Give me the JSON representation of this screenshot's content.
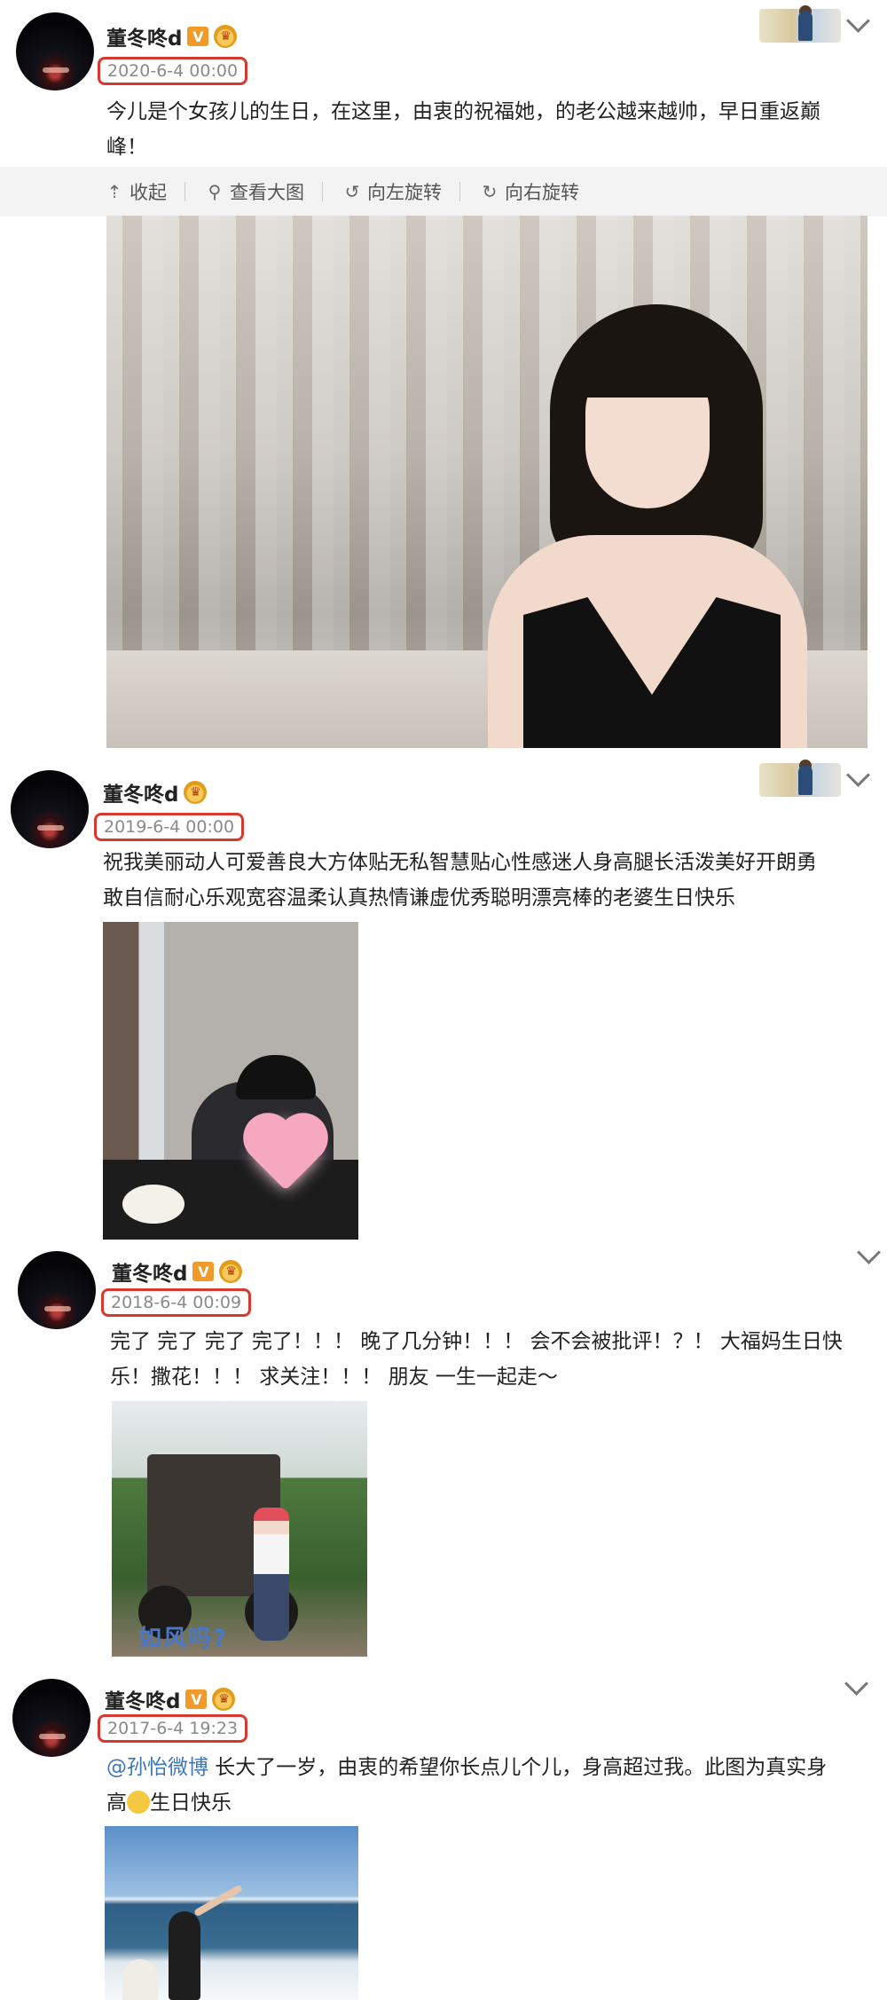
{
  "posts": [
    {
      "username": "董冬咚d",
      "timestamp": "2020-6-4 00:00",
      "content": "今儿是个女孩儿的生日，在这里，由衷的祝福她，的老公越来越帅，早日重返巅峰！",
      "content_lines": [
        "今儿是个女孩儿的生日，在这里，由衷的祝福她，的老公越来越帅，早日重返巅",
        "峰！"
      ],
      "toolbar": {
        "collapse": "收起",
        "view_large": "查看大图",
        "rotate_left": "向左旋转",
        "rotate_right": "向右旋转"
      }
    },
    {
      "username": "董冬咚d",
      "timestamp": "2019-6-4 00:00",
      "content_lines": [
        "祝我美丽动人可爱善良大方体贴无私智慧贴心性感迷人身高腿长活泼美好开朗勇",
        "敢自信耐心乐观宽容温柔认真热情谦虚优秀聪明漂亮棒的老婆生日快乐"
      ]
    },
    {
      "username": "董冬咚d",
      "timestamp": "2018-6-4 00:09",
      "content_lines": [
        "完了 完了 完了 完了！！！ 晚了几分钟！！！ 会不会被批评！？！ 大福妈生日快",
        "乐！撒花！！！ 求关注！！！ 朋友 一生一起走～"
      ],
      "image_watermark": "如风吗?"
    },
    {
      "username": "董冬咚d",
      "timestamp": "2017-6-4 19:23",
      "mention": "@孙怡微博",
      "content_line1_rest": " 长大了一岁，由衷的希望你长点儿个儿，身高超过我。此图为真实身",
      "content_line2_pre": "高",
      "content_line2_post": "生日快乐"
    }
  ],
  "badges": {
    "verified": "V",
    "accent_color": "#f09a2a",
    "highlight_color": "#d9382f"
  },
  "icons": [
    "collapse-icon",
    "search-icon",
    "rotate-left-icon",
    "rotate-right-icon",
    "chevron-down-icon",
    "smile-emoji-icon"
  ]
}
